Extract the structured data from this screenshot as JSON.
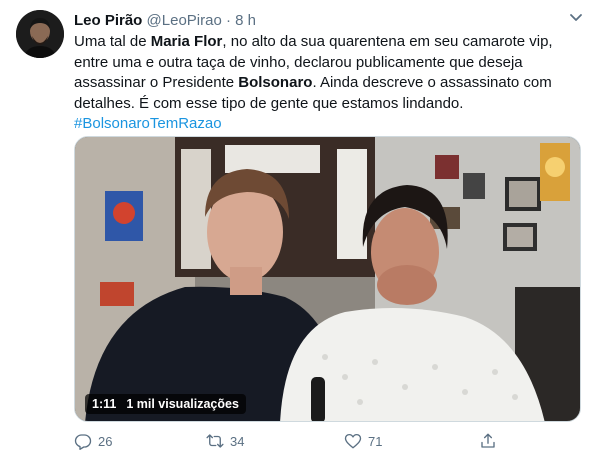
{
  "tweet": {
    "author_name": "Leo Pirão",
    "author_handle": "@LeoPirao",
    "separator": "·",
    "time": "8 h",
    "text_lines": [
      [
        {
          "t": "Uma tal de ",
          "b": false
        },
        {
          "t": "Maria Flor",
          "b": true
        },
        {
          "t": ", no alto da sua quarentena em seu camarote vip,",
          "b": false
        }
      ],
      [
        {
          "t": "entre uma e outra taça de vinho, declarou publicamente que deseja",
          "b": false
        }
      ],
      [
        {
          "t": "assassinar o Presidente ",
          "b": false
        },
        {
          "t": "Bolsonaro",
          "b": true
        },
        {
          "t": ". Ainda descreve o assassinato com",
          "b": false
        }
      ],
      [
        {
          "t": "detalhes. É com esse tipo de gente que estamos lindando.",
          "b": false
        }
      ]
    ],
    "hashtag": "#BolsonaroTemRazao"
  },
  "video": {
    "duration": "1:11",
    "views": "1 mil visualizações"
  },
  "actions": {
    "reply_count": "26",
    "retweet_count": "34",
    "like_count": "71"
  },
  "icons": {
    "caret": "chevron-down-icon",
    "reply": "reply-icon",
    "retweet": "retweet-icon",
    "like": "heart-icon",
    "share": "share-icon"
  },
  "colors": {
    "hashtag": "#1b95e0",
    "secondary_text": "#5b7083"
  }
}
